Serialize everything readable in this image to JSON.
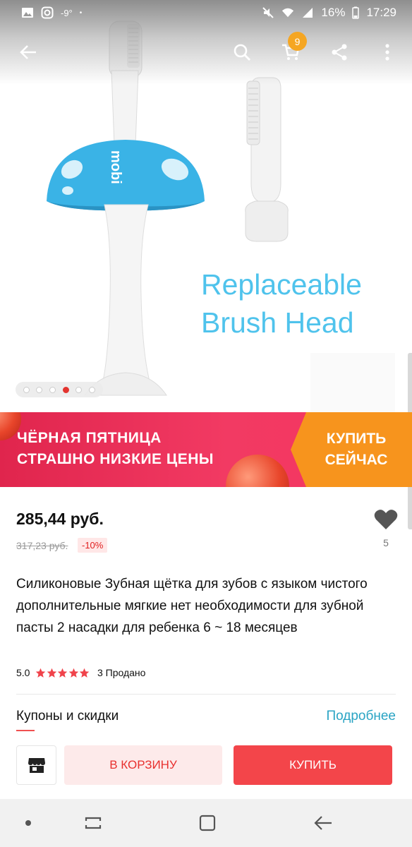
{
  "status_bar": {
    "temperature": "-9°",
    "battery": "16%",
    "time": "17:29"
  },
  "toolbar": {
    "cart_count": "9",
    "icons": [
      "back-arrow-icon",
      "search-icon",
      "cart-icon",
      "share-icon",
      "more-vertical-icon"
    ]
  },
  "gallery": {
    "overlay_line1": "Replaceable",
    "overlay_line2": "Brush Head",
    "brand_text": "mobi",
    "dots": 6,
    "active_dot": 4
  },
  "promo": {
    "line1": "ЧЁРНАЯ ПЯТНИЦА",
    "line2": "СТРАШНО НИЗКИЕ ЦЕНЫ",
    "cta_line1": "КУПИТЬ",
    "cta_line2": "СЕЙЧАС"
  },
  "product": {
    "price": "285,44 руб.",
    "old_price": "317,23 руб.",
    "discount": "-10%",
    "wishlist_count": "5",
    "title": "Силиконовые Зубная щётка для зубов с языком чистого дополнительные мягкие нет необходимости для зубной пасты 2 насадки для ребенка 6 ~ 18 месяцев",
    "rating": "5.0",
    "stars": 5,
    "sold": "3 Продано"
  },
  "coupons": {
    "label": "Купоны и скидки",
    "more": "Подробнее"
  },
  "actions": {
    "add_to_cart": "В КОРЗИНУ",
    "buy": "КУПИТЬ"
  },
  "colors": {
    "accent_red": "#f3454a",
    "promo_orange": "#f7941d",
    "link_blue": "#2aa4c4",
    "mushroom_blue": "#3ab3e6"
  }
}
